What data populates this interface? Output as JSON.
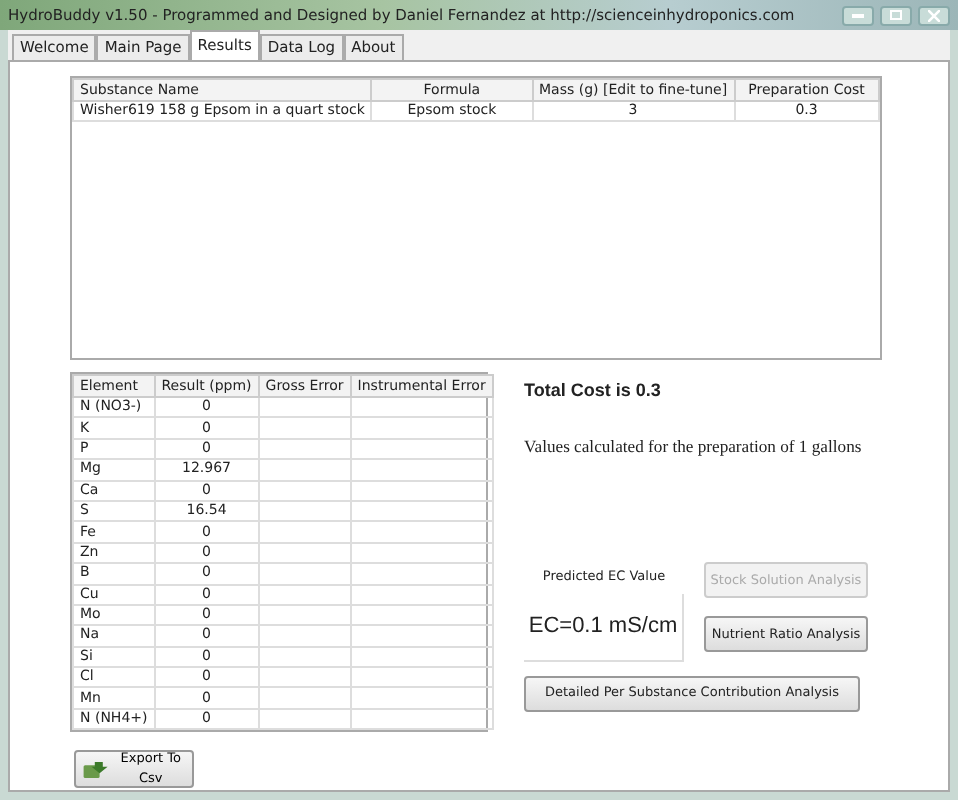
{
  "window": {
    "title": "HydroBuddy v1.50 - Programmed and Designed by Daniel Fernandez at http://scienceinhydroponics.com"
  },
  "tabs": [
    {
      "label": "Welcome",
      "selected": false
    },
    {
      "label": "Main Page",
      "selected": false
    },
    {
      "label": "Results",
      "selected": true
    },
    {
      "label": "Data Log",
      "selected": false
    },
    {
      "label": "About",
      "selected": false
    }
  ],
  "substances": {
    "columns": [
      "Substance Name",
      "Formula",
      "Mass (g) [Edit to fine-tune]",
      "Preparation Cost"
    ],
    "rows": [
      [
        "Wisher619 158 g Epsom in a quart stock",
        "Epsom stock",
        "3",
        "0.3"
      ]
    ]
  },
  "elements": {
    "columns": [
      "Element",
      "Result (ppm)",
      "Gross Error",
      "Instrumental Error"
    ],
    "rows": [
      {
        "element": "N (NO3-)",
        "result": "0"
      },
      {
        "element": "K",
        "result": "0"
      },
      {
        "element": "P",
        "result": "0"
      },
      {
        "element": "Mg",
        "result": "12.967"
      },
      {
        "element": "Ca",
        "result": "0"
      },
      {
        "element": "S",
        "result": "16.54"
      },
      {
        "element": "Fe",
        "result": "0"
      },
      {
        "element": "Zn",
        "result": "0"
      },
      {
        "element": "B",
        "result": "0"
      },
      {
        "element": "Cu",
        "result": "0"
      },
      {
        "element": "Mo",
        "result": "0"
      },
      {
        "element": "Na",
        "result": "0"
      },
      {
        "element": "Si",
        "result": "0"
      },
      {
        "element": "Cl",
        "result": "0"
      },
      {
        "element": "Mn",
        "result": "0"
      },
      {
        "element": "N (NH4+)",
        "result": "0"
      }
    ]
  },
  "total_cost": "Total Cost is 0.3",
  "note": "Values calculated for the preparation of 1 gallons",
  "ec": {
    "label": "Predicted EC Value",
    "value": "EC=0.1 mS/cm"
  },
  "buttons": [
    {
      "label": "Stock Solution Analysis",
      "disabled": true
    },
    {
      "label": "Nutrient Ratio Analysis",
      "disabled": false
    },
    {
      "label": "Detailed Per Substance Contribution Analysis",
      "disabled": false
    }
  ],
  "export_button": {
    "label": "Export To Csv"
  }
}
